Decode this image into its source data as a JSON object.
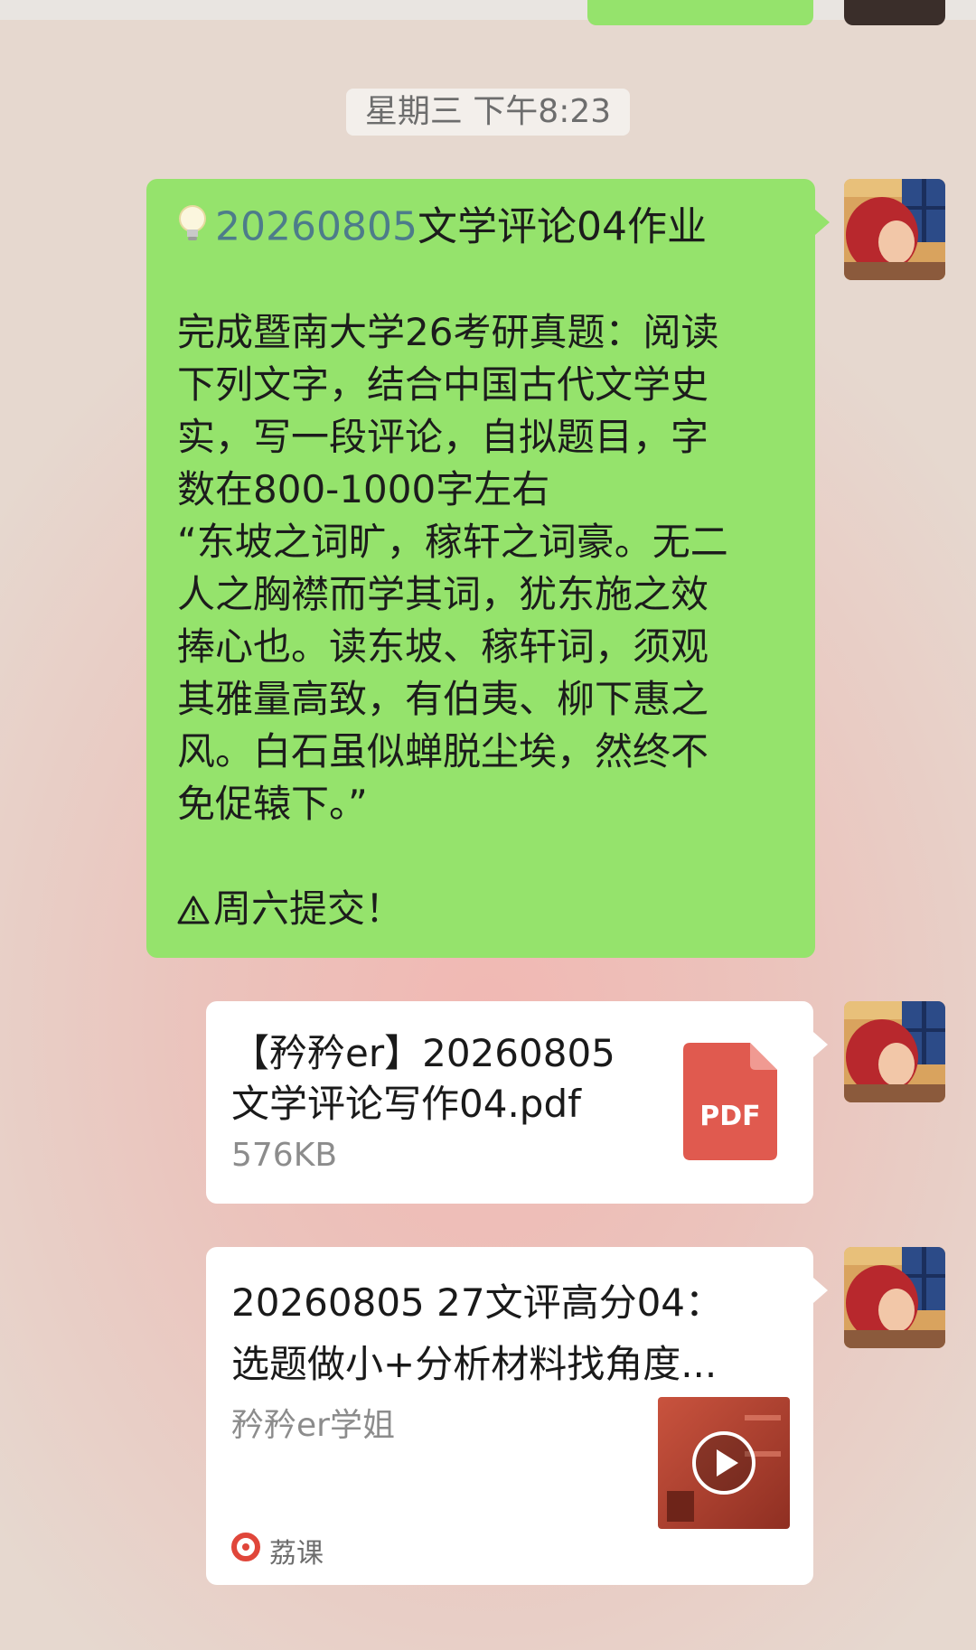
{
  "timestamp": "星期三 下午8:23",
  "message": {
    "title_date": "20260805",
    "title_rest": "文学评论04作业",
    "body": "完成暨南大学26考研真题：阅读\n下列文字，结合中国古代文学史\n实，写一段评论，自拟题目，字\n数在800-1000字左右\n“东坡之词旷，稼轩之词豪。无二\n人之胸襟而学其词，犹东施之效\n捧心也。读东坡、稼轩词，须观\n其雅量高致，有伯夷、柳下惠之\n风。白石虽似蝉脱尘埃，然终不\n免促辕下。”",
    "warning": "周六提交！",
    "bulb_icon": "lightbulb-icon",
    "warning_icon": "warning-icon"
  },
  "file": {
    "name": "【矜矜er】20260805\n文学评论写作04.pdf",
    "size": "576KB",
    "icon_label": "PDF",
    "icon_color": "#e05a4f"
  },
  "video": {
    "title": "20260805 27文评高分04：\n选题做小+分析材料找角度...",
    "author": "矜矜er学姐",
    "source": "荔课",
    "source_color": "#e0463a"
  },
  "colors": {
    "green_bubble": "#95e36c",
    "link": "#4d7c8a"
  }
}
